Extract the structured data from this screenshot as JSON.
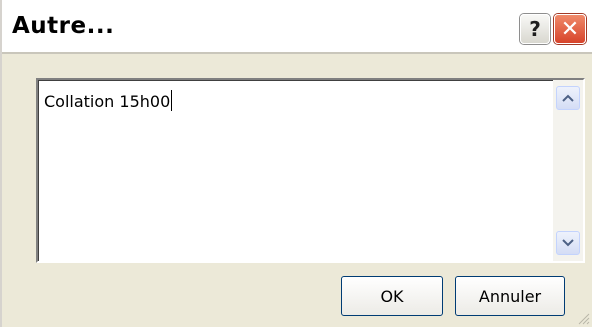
{
  "window": {
    "title": "Autre...",
    "help_glyph": "?",
    "close_glyph": "✕"
  },
  "textarea": {
    "value": "Collation 15h00"
  },
  "buttons": {
    "ok_label": "OK",
    "cancel_label": "Annuler"
  },
  "icons": {
    "help": "help-icon",
    "close": "close-icon",
    "scroll_up": "chevron-up-icon",
    "scroll_down": "chevron-down-icon",
    "resize": "resize-grip-icon"
  },
  "colors": {
    "close_button": "#d7432a",
    "dialog_face": "#ece9d8",
    "button_border": "#003c74",
    "scroll_arrow": "#4d6185"
  }
}
